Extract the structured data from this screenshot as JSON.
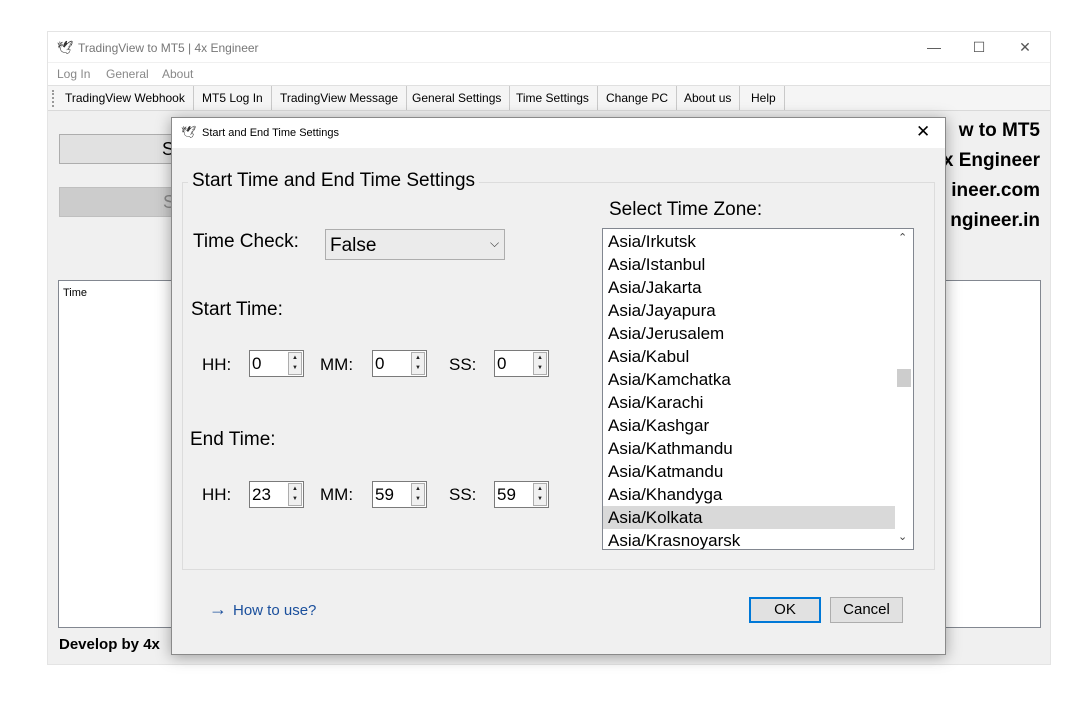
{
  "app": {
    "title": "TradingView to MT5 | 4x Engineer",
    "icon": "logo-icon",
    "window_controls": {
      "minimize": "—",
      "maximize": "☐",
      "close": "✕"
    }
  },
  "menu": {
    "items": [
      "Log In",
      "General",
      "About"
    ]
  },
  "toolbar": {
    "items": [
      "TradingView Webhook",
      "MT5 Log In",
      "TradingView Message",
      "General Settings",
      "Time Settings",
      "Change PC",
      "About us",
      "Help"
    ]
  },
  "main": {
    "start_label": "Start",
    "stop_label": "Stop",
    "time_column": "Time",
    "brand_lines": [
      "w to MT5",
      "x Engineer",
      "ineer.com",
      "ngineer.in"
    ],
    "develop_by": "Develop by 4x"
  },
  "dialog": {
    "title": "Start and End Time Settings",
    "close": "✕",
    "group_title": "Start Time and End Time Settings",
    "time_check_label": "Time Check:",
    "time_check_value": "False",
    "start_time_label": "Start Time:",
    "end_time_label": "End Time:",
    "hh_label": "HH:",
    "mm_label": "MM:",
    "ss_label": "SS:",
    "start": {
      "hh": "0",
      "mm": "0",
      "ss": "0"
    },
    "end": {
      "hh": "23",
      "mm": "59",
      "ss": "59"
    },
    "timezone_label": "Select Time Zone:",
    "timezones": [
      "Asia/Irkutsk",
      "Asia/Istanbul",
      "Asia/Jakarta",
      "Asia/Jayapura",
      "Asia/Jerusalem",
      "Asia/Kabul",
      "Asia/Kamchatka",
      "Asia/Karachi",
      "Asia/Kashgar",
      "Asia/Kathmandu",
      "Asia/Katmandu",
      "Asia/Khandyga",
      "Asia/Kolkata",
      "Asia/Krasnoyarsk"
    ],
    "selected_timezone": "Asia/Kolkata",
    "how_to_use": "How to use?",
    "ok": "OK",
    "cancel": "Cancel"
  },
  "colors": {
    "accent": "#0078d7",
    "link": "#1a4f9c",
    "selection": "#d9d9d9"
  }
}
